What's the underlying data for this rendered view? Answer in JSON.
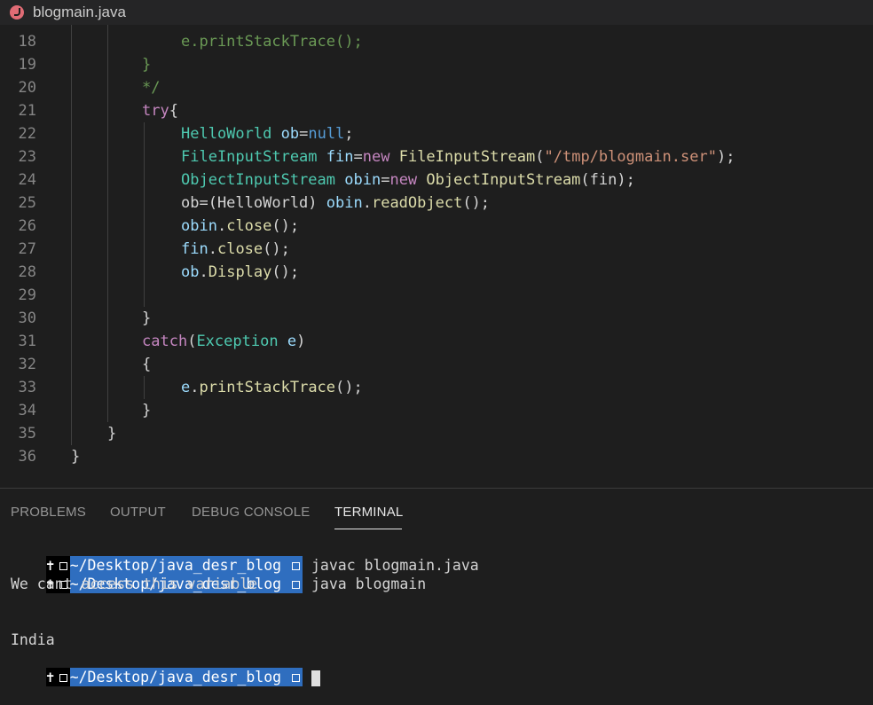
{
  "tab": {
    "title": "blogmain.java",
    "icon": "java-file-icon"
  },
  "editor": {
    "lines": [
      {
        "num": "18",
        "tokens": [
          {
            "t": "e.printStackTrace();",
            "c": "cm"
          }
        ]
      },
      {
        "num": "19",
        "tokens": [
          {
            "t": "}",
            "c": "cm"
          }
        ]
      },
      {
        "num": "20",
        "tokens": [
          {
            "t": "*/",
            "c": "cm"
          }
        ]
      },
      {
        "num": "21",
        "tokens": [
          {
            "t": "try",
            "c": "kw"
          },
          {
            "t": "{",
            "c": "pl"
          }
        ]
      },
      {
        "num": "22",
        "tokens": [
          {
            "t": "HelloWorld",
            "c": "ty"
          },
          {
            "t": " ",
            "c": "pl"
          },
          {
            "t": "ob",
            "c": "vr"
          },
          {
            "t": "=",
            "c": "pl"
          },
          {
            "t": "null",
            "c": "bl"
          },
          {
            "t": ";",
            "c": "pl"
          }
        ]
      },
      {
        "num": "23",
        "tokens": [
          {
            "t": "FileInputStream",
            "c": "ty"
          },
          {
            "t": " ",
            "c": "pl"
          },
          {
            "t": "fin",
            "c": "vr"
          },
          {
            "t": "=",
            "c": "pl"
          },
          {
            "t": "new",
            "c": "kw"
          },
          {
            "t": " ",
            "c": "pl"
          },
          {
            "t": "FileInputStream",
            "c": "fn"
          },
          {
            "t": "(",
            "c": "pl"
          },
          {
            "t": "\"/tmp/blogmain.ser\"",
            "c": "st"
          },
          {
            "t": ");",
            "c": "pl"
          }
        ]
      },
      {
        "num": "24",
        "tokens": [
          {
            "t": "ObjectInputStream",
            "c": "ty"
          },
          {
            "t": " ",
            "c": "pl"
          },
          {
            "t": "obin",
            "c": "vr"
          },
          {
            "t": "=",
            "c": "pl"
          },
          {
            "t": "new",
            "c": "kw"
          },
          {
            "t": " ",
            "c": "pl"
          },
          {
            "t": "ObjectInputStream",
            "c": "fn"
          },
          {
            "t": "(fin);",
            "c": "pl"
          }
        ]
      },
      {
        "num": "25",
        "tokens": [
          {
            "t": "ob=(HelloWorld) ",
            "c": "pl"
          },
          {
            "t": "obin",
            "c": "vr"
          },
          {
            "t": ".",
            "c": "pl"
          },
          {
            "t": "readObject",
            "c": "fn"
          },
          {
            "t": "();",
            "c": "pl"
          }
        ]
      },
      {
        "num": "26",
        "tokens": [
          {
            "t": "obin",
            "c": "vr"
          },
          {
            "t": ".",
            "c": "pl"
          },
          {
            "t": "close",
            "c": "fn"
          },
          {
            "t": "();",
            "c": "pl"
          }
        ]
      },
      {
        "num": "27",
        "tokens": [
          {
            "t": "fin",
            "c": "vr"
          },
          {
            "t": ".",
            "c": "pl"
          },
          {
            "t": "close",
            "c": "fn"
          },
          {
            "t": "();",
            "c": "pl"
          }
        ]
      },
      {
        "num": "28",
        "tokens": [
          {
            "t": "ob",
            "c": "vr"
          },
          {
            "t": ".",
            "c": "pl"
          },
          {
            "t": "Display",
            "c": "fn"
          },
          {
            "t": "();",
            "c": "pl"
          }
        ]
      },
      {
        "num": "29",
        "tokens": []
      },
      {
        "num": "30",
        "tokens": [
          {
            "t": "}",
            "c": "pl"
          }
        ]
      },
      {
        "num": "31",
        "tokens": [
          {
            "t": "catch",
            "c": "kw"
          },
          {
            "t": "(",
            "c": "pl"
          },
          {
            "t": "Exception",
            "c": "ty"
          },
          {
            "t": " ",
            "c": "pl"
          },
          {
            "t": "e",
            "c": "vr"
          },
          {
            "t": ")",
            "c": "pl"
          }
        ]
      },
      {
        "num": "32",
        "tokens": [
          {
            "t": "{",
            "c": "pl"
          }
        ]
      },
      {
        "num": "33",
        "tokens": [
          {
            "t": "e",
            "c": "vr"
          },
          {
            "t": ".",
            "c": "pl"
          },
          {
            "t": "printStackTrace",
            "c": "fn"
          },
          {
            "t": "();",
            "c": "pl"
          }
        ]
      },
      {
        "num": "34",
        "tokens": [
          {
            "t": "}",
            "c": "pl"
          }
        ]
      },
      {
        "num": "35",
        "tokens": [
          {
            "t": "}",
            "c": "pl"
          }
        ]
      },
      {
        "num": "36",
        "tokens": [
          {
            "t": "}",
            "c": "pl"
          }
        ]
      }
    ]
  },
  "panel": {
    "tabs": [
      "PROBLEMS",
      "OUTPUT",
      "DEBUG CONSOLE",
      "TERMINAL"
    ],
    "active_tab": "TERMINAL"
  },
  "terminal": {
    "prompt_path": "~/Desktop/java_desr_blog",
    "prompt_symbol": "✝",
    "commands": [
      "javac blogmain.java",
      "java blogmain"
    ],
    "output": [
      "We cant access this variable",
      "",
      "",
      "India"
    ]
  },
  "colors": {
    "keyword": "#c586c0",
    "type": "#4ec9b0",
    "variable": "#9cdcfe",
    "function": "#dcdcaa",
    "string": "#ce9178",
    "comment": "#6a9955",
    "prompt_bg": "#2f6ebf"
  }
}
